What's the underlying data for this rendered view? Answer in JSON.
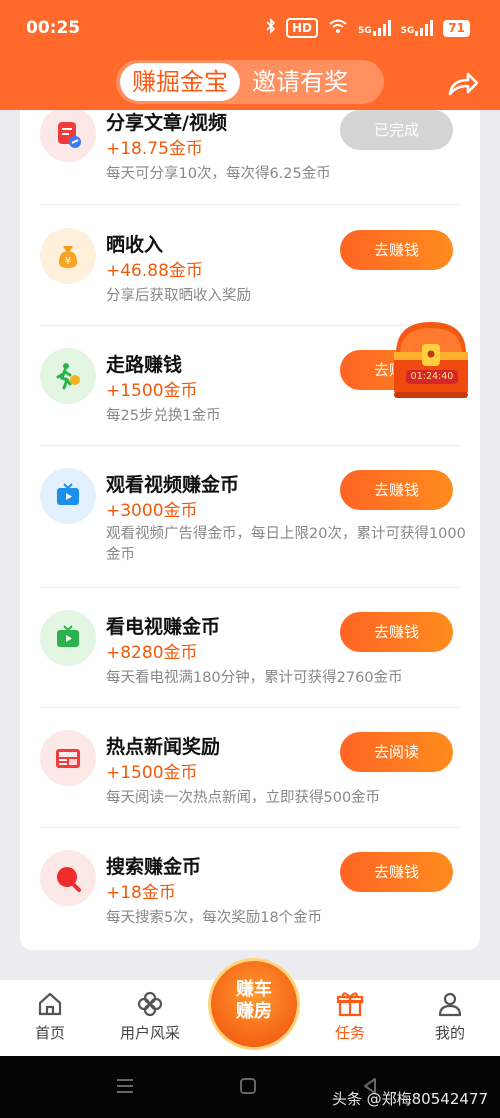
{
  "status_bar": {
    "time": "00:25",
    "indicators": [
      "bluetooth",
      "HD",
      "wifi",
      "5G",
      "5G"
    ],
    "hd_label": "HD",
    "net1": "5G",
    "net2": "5G",
    "battery": "71"
  },
  "header": {
    "tab_active": "赚掘金宝",
    "tab_inactive": "邀请有奖",
    "share_icon": "share-icon"
  },
  "tasks": [
    {
      "title": "分享文章/视频",
      "reward": "+18.75金币",
      "desc": "每天可分享10次，每次得6.25金币",
      "button": "已完成",
      "icon": "share-article-icon"
    },
    {
      "title": "晒收入",
      "reward": "+46.88金币",
      "desc": "分享后获取晒收入奖励",
      "button": "去赚钱",
      "icon": "money-bag-icon"
    },
    {
      "title": "走路赚钱",
      "reward": "+1500金币",
      "desc": "每25步兑换1金币",
      "button": "去赚钱",
      "icon": "walking-icon"
    },
    {
      "title": "观看视频赚金币",
      "reward": "+3000金币",
      "desc": "观看视频广告得金币，每日上限20次，累计可获得1000金币",
      "button": "去赚钱",
      "icon": "tv-video-icon"
    },
    {
      "title": "看电视赚金币",
      "reward": "+8280金币",
      "desc": "每天看电视满180分钟，累计可获得2760金币",
      "button": "去赚钱",
      "icon": "tv-play-icon"
    },
    {
      "title": "热点新闻奖励",
      "reward": "+1500金币",
      "desc": "每天阅读一次热点新闻，立即获得500金币",
      "button": "去阅读",
      "icon": "news-icon"
    },
    {
      "title": "搜索赚金币",
      "reward": "+18金币",
      "desc": "每天搜索5次，每次奖励18个金币",
      "button": "去赚钱",
      "icon": "search-icon"
    }
  ],
  "treasure_chest": {
    "timer": "01:24:40"
  },
  "bottom_nav": {
    "home": "首页",
    "collect": "用户风采",
    "center_line1": "赚车",
    "center_line2": "赚房",
    "tasks": "任务",
    "mine": "我的"
  },
  "watermark": "头条 @郑梅80542477",
  "colors": {
    "accent": "#ff6a2a",
    "reward": "#f25a0a",
    "button_gradient_start": "#ff6424",
    "button_gradient_end": "#ff8c1e"
  }
}
